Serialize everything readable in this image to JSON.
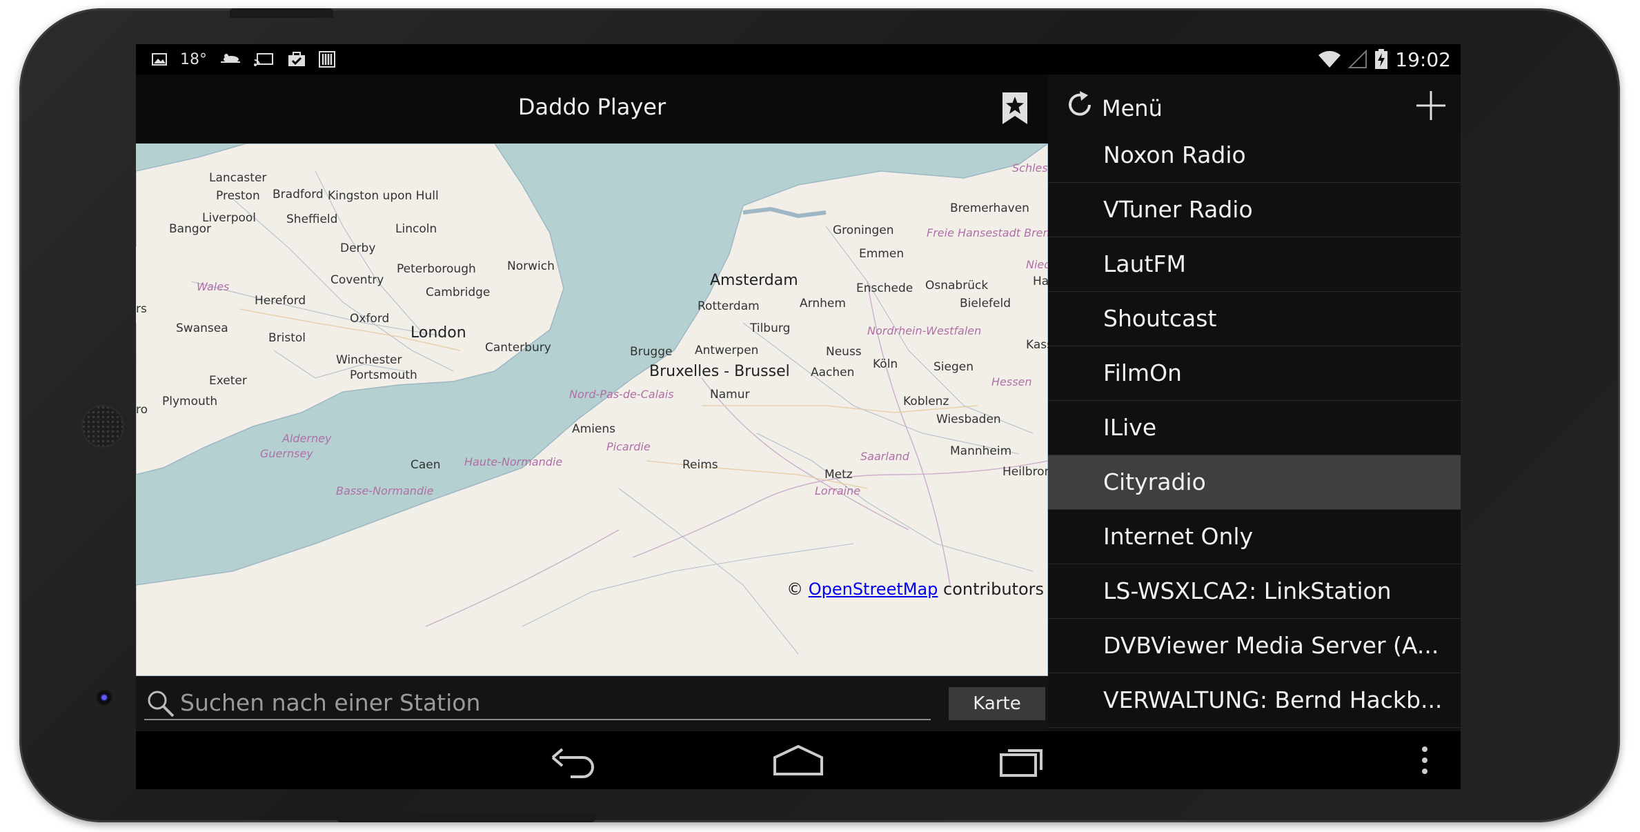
{
  "status_bar": {
    "temperature": "18°",
    "time": "19:02"
  },
  "app": {
    "title": "Daddo Player"
  },
  "map": {
    "attribution_prefix": "©",
    "attribution_link": "OpenStreetMap",
    "attribution_suffix": "contributors",
    "labels": {
      "lancaster": "Lancaster",
      "preston": "Preston",
      "bradford": "Bradford",
      "kingston": "Kingston upon Hull",
      "liverpool": "Liverpool",
      "sheffield": "Sheffield",
      "bangor": "Bangor",
      "lincoln": "Lincoln",
      "derby": "Derby",
      "peterborough": "Peterborough",
      "norwich": "Norwich",
      "coventry": "Coventry",
      "wales": "Wales",
      "cambridge": "Cambridge",
      "hereford": "Hereford",
      "oxford": "Oxford",
      "swansea": "Swansea",
      "bristol": "Bristol",
      "london": "London",
      "canterbury": "Canterbury",
      "winchester": "Winchester",
      "portsmouth": "Portsmouth",
      "exeter": "Exeter",
      "plymouth": "Plymouth",
      "alderney": "Alderney",
      "guernsey": "Guernsey",
      "caen": "Caen",
      "basse_normandie": "Basse-Normandie",
      "haute_normandie": "Haute-Normandie",
      "picardie": "Picardie",
      "amiens": "Amiens",
      "reims": "Reims",
      "nord_pas_de_calais": "Nord-Pas-de-Calais",
      "brugge": "Brugge",
      "antwerpen": "Antwerpen",
      "bruxelles": "Bruxelles - Brussel",
      "namur": "Namur",
      "tilburg": "Tilburg",
      "rotterdam": "Rotterdam",
      "amsterdam": "Amsterdam",
      "arnhem": "Arnhem",
      "enschede": "Enschede",
      "emmen": "Emmen",
      "groningen": "Groningen",
      "bremerhaven": "Bremerhaven",
      "freie_hansestadt": "Freie Hansestadt Brem",
      "osnabrueck": "Osnabrück",
      "bielefeld": "Bielefeld",
      "nrw": "Nordrhein-Westfalen",
      "neuss": "Neuss",
      "koeln": "Köln",
      "aachen": "Aachen",
      "siegen": "Siegen",
      "hessen": "Hessen",
      "koblenz": "Koblenz",
      "wiesbaden": "Wiesbaden",
      "mannheim": "Mannheim",
      "saarland": "Saarland",
      "metz": "Metz",
      "lorraine": "Lorraine",
      "heilbronn": "Heilbronn",
      "schles": "Schles",
      "nied": "Nied",
      "ha": "Ha",
      "kass": "Kass",
      "es": "rs",
      "ro": "ro"
    }
  },
  "search": {
    "placeholder": "Suchen nach einer Station",
    "value": "",
    "button_label": "Karte"
  },
  "menu": {
    "title": "Menü",
    "items": [
      {
        "label": "Noxon Radio",
        "selected": false
      },
      {
        "label": "VTuner Radio",
        "selected": false
      },
      {
        "label": "LautFM",
        "selected": false
      },
      {
        "label": "Shoutcast",
        "selected": false
      },
      {
        "label": "FilmOn",
        "selected": false
      },
      {
        "label": "ILive",
        "selected": false
      },
      {
        "label": "Cityradio",
        "selected": true
      },
      {
        "label": "Internet Only",
        "selected": false
      },
      {
        "label": "LS-WSXLCA2: LinkStation",
        "selected": false
      },
      {
        "label": "DVBViewer Media Server (A...",
        "selected": false
      },
      {
        "label": "VERWALTUNG: Bernd Hackb...",
        "selected": false
      }
    ]
  },
  "colors": {
    "map_sea": "#b5d0d0",
    "map_land": "#f2efe9",
    "selected_item": "#3f3f3f",
    "link": "#0000ee"
  },
  "icons": {
    "status_left": [
      "image-icon",
      "weather-icon",
      "cast-icon",
      "briefcase-icon",
      "barcode-icon"
    ],
    "status_right": [
      "wifi-icon",
      "signal-icon",
      "battery-charging-icon"
    ],
    "nav": [
      "back-icon",
      "home-icon",
      "recent-apps-icon",
      "overflow-menu-icon"
    ]
  }
}
